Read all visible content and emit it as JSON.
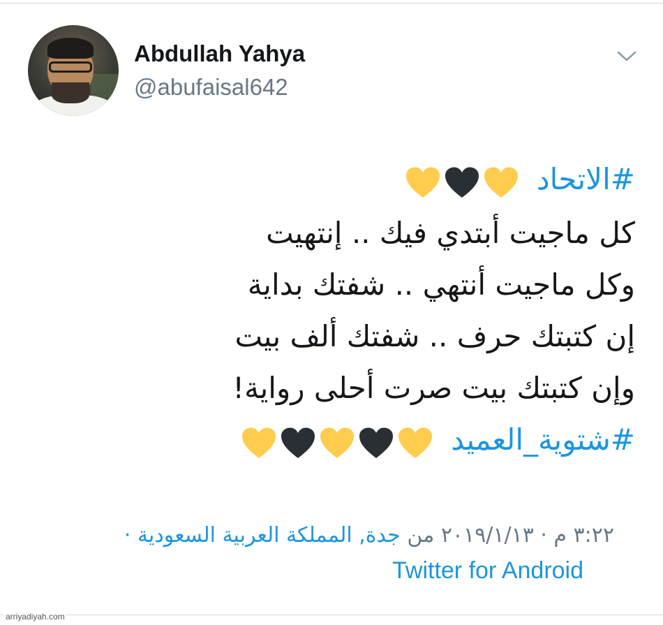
{
  "user": {
    "display_name": "Abdullah Yahya",
    "handle": "@abufaisal642"
  },
  "tweet": {
    "hashtag_1": "#الاتحاد",
    "line_1": "كل ماجيت أبتدي فيك .. إنتهيت",
    "line_2": "وكل ماجيت أنتهي .. شفتك بداية",
    "line_3": "إن كتبتك حرف .. شفتك ألف بيت",
    "line_4": "وإن كتبتك بيت صرت أحلى رواية!",
    "hashtag_2": "#شتوية_العميد",
    "hearts_1": [
      "yellow",
      "black",
      "yellow"
    ],
    "hearts_2": [
      "yellow",
      "black",
      "yellow",
      "black",
      "yellow"
    ]
  },
  "meta": {
    "time_date": "٣:٢٢ م · ٢٠١٩/١/١٣ من",
    "location": "جدة, المملكة العربية السعودية ·",
    "source": "Twitter for Android"
  },
  "watermark": "arriyadiyah.com",
  "colors": {
    "link": "#1b95e0",
    "muted": "#657786",
    "heart_yellow": "#ffcc4d",
    "heart_black": "#292f33"
  },
  "icons": {
    "more": "chevron-down-icon",
    "heart_yellow": "yellow-heart-emoji",
    "heart_black": "black-heart-emoji"
  }
}
